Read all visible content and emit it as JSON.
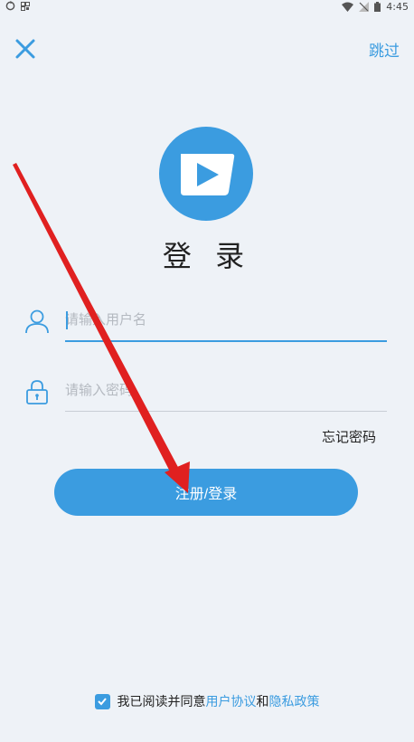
{
  "status_bar": {
    "time": "4:45"
  },
  "header": {
    "skip_label": "跳过"
  },
  "login": {
    "title": "登 录",
    "username_placeholder": "请输入用户名",
    "password_placeholder": "请输入密码",
    "forgot_label": "忘记密码",
    "submit_label": "注册/登录"
  },
  "agreement": {
    "prefix": "我已阅读并同意",
    "user_agreement": "用户协议",
    "and": "和",
    "privacy_policy": "隐私政策",
    "checked": true
  },
  "icons": {
    "close": "close-icon",
    "user": "user-icon",
    "lock": "lock-icon",
    "logo": "play-logo-icon",
    "check": "check-icon"
  },
  "colors": {
    "accent": "#3b9ce0",
    "background": "#eef2f7",
    "arrow": "#e02020"
  }
}
